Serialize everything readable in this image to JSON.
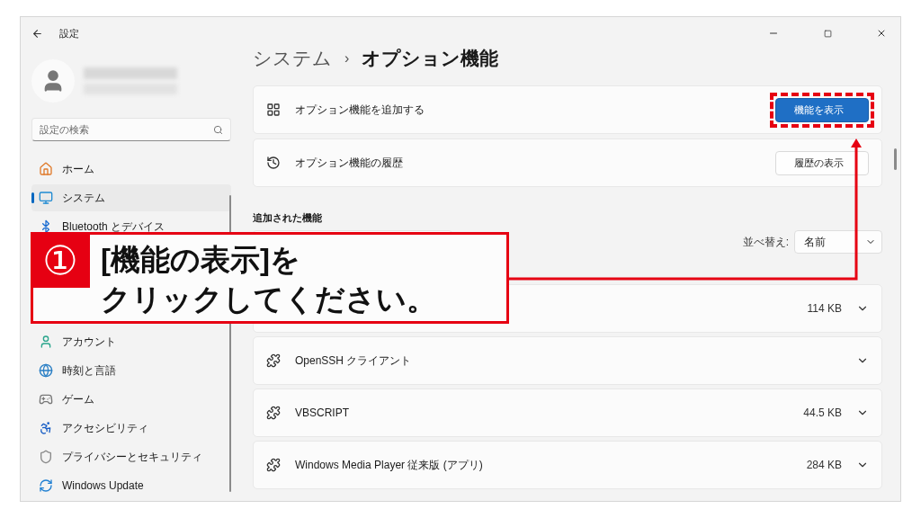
{
  "window": {
    "title": "設定"
  },
  "search": {
    "placeholder": "設定の検索"
  },
  "sidebar": {
    "items": [
      {
        "label": "ホーム",
        "selected": false
      },
      {
        "label": "システム",
        "selected": true
      },
      {
        "label": "Bluetooth とデバイス",
        "selected": false
      },
      {
        "label": "アカウント",
        "selected": false
      },
      {
        "label": "時刻と言語",
        "selected": false
      },
      {
        "label": "ゲーム",
        "selected": false
      },
      {
        "label": "アクセシビリティ",
        "selected": false
      },
      {
        "label": "プライバシーとセキュリティ",
        "selected": false
      },
      {
        "label": "Windows Update",
        "selected": false
      }
    ]
  },
  "breadcrumb": {
    "parent": "システム",
    "separator": "›",
    "current": "オプション機能"
  },
  "cards": [
    {
      "label": "オプション機能を追加する",
      "button": "機能を表示",
      "primary": true
    },
    {
      "label": "オプション機能の履歴",
      "button": "履歴の表示",
      "primary": false
    }
  ],
  "added": {
    "heading": "追加された機能",
    "sort_label": "並べ替え:",
    "sort_value": "名前",
    "features": [
      {
        "size": "114 KB"
      },
      {
        "name": "OpenSSH クライアント"
      },
      {
        "name": "VBSCRIPT",
        "size": "44.5 KB"
      },
      {
        "name": "Windows Media Player 従来版 (アプリ)",
        "size": "284 KB"
      }
    ]
  },
  "callout": {
    "number": "①",
    "lines": [
      "[機能の表示]を",
      "クリックしてください。"
    ]
  }
}
